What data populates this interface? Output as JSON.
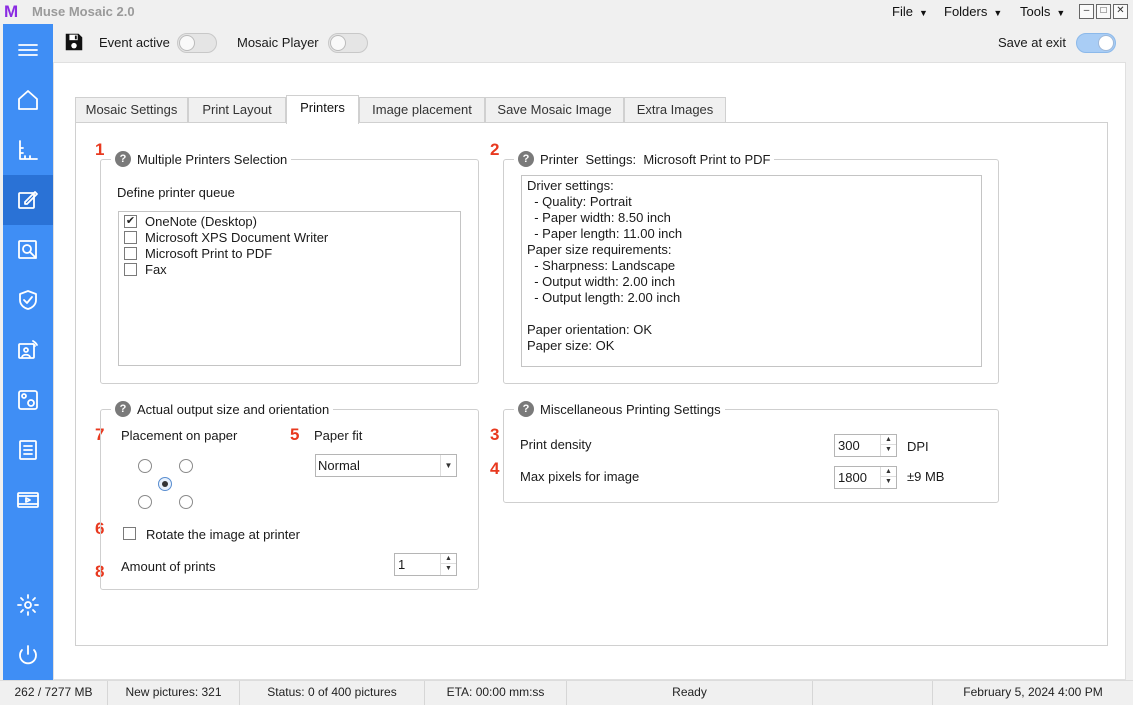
{
  "app": {
    "title": "Muse Mosaic 2.0",
    "logo": "M"
  },
  "menu": [
    "File",
    "Folders",
    "Tools"
  ],
  "window_buttons": [
    "minimize-icon",
    "maximize-icon",
    "close-icon"
  ],
  "sidebar": {
    "items": [
      {
        "icon": "hamburger-menu-icon"
      },
      {
        "icon": "home-icon"
      },
      {
        "icon": "ruler-icon"
      },
      {
        "icon": "edit-icon"
      },
      {
        "icon": "search-image-icon"
      },
      {
        "icon": "shield-check-icon"
      },
      {
        "icon": "presentation-icon"
      },
      {
        "icon": "image-settings-icon"
      },
      {
        "icon": "checklist-icon"
      },
      {
        "icon": "video-icon"
      },
      {
        "icon": "gear-icon"
      },
      {
        "icon": "power-icon"
      }
    ],
    "active_index": 3,
    "accent_color": "#3f8ef5"
  },
  "toolbar": {
    "event_active_label": "Event active",
    "event_active": false,
    "mosaic_player_label": "Mosaic Player",
    "mosaic_player": false,
    "save_at_exit_label": "Save at exit",
    "save_at_exit": true
  },
  "tabs": [
    {
      "label": "Mosaic Settings",
      "active": false
    },
    {
      "label": "Print Layout",
      "active": false
    },
    {
      "label": "Printers",
      "active": true
    },
    {
      "label": "Image placement",
      "active": false
    },
    {
      "label": "Save Mosaic Image",
      "active": false
    },
    {
      "label": "Extra Images",
      "active": false
    }
  ],
  "markers": [
    "1",
    "2",
    "3",
    "4",
    "5",
    "6",
    "7",
    "8"
  ],
  "multiple_printers": {
    "title": "Multiple Printers Selection",
    "queue_label": "Define printer queue",
    "printers": [
      {
        "name": "OneNote (Desktop)",
        "checked": true
      },
      {
        "name": "Microsoft XPS Document Writer",
        "checked": false
      },
      {
        "name": "Microsoft Print to PDF",
        "checked": false
      },
      {
        "name": "Fax",
        "checked": false
      }
    ]
  },
  "printer_settings": {
    "title": "Printer  Settings:  Microsoft Print to PDF",
    "lines": [
      "Driver settings:",
      "  - Quality: Portrait",
      "  - Paper width: 8.50 inch",
      "  - Paper length: 11.00 inch",
      "Paper size requirements:",
      "  - Sharpness: Landscape",
      "  - Output width: 2.00 inch",
      "  - Output length: 2.00 inch",
      "",
      "Paper orientation: OK",
      "Paper size: OK"
    ]
  },
  "output_size": {
    "title": "Actual output size and orientation",
    "placement_label": "Placement on paper",
    "placement_selected": "center",
    "paper_fit_label": "Paper fit",
    "paper_fit_value": "Normal",
    "rotate_label": "Rotate the image at printer",
    "rotate_checked": false,
    "amount_label": "Amount of prints",
    "amount_value": "1"
  },
  "misc": {
    "title": "Miscellaneous Printing Settings",
    "density_label": "Print density",
    "density_value": "300",
    "density_unit": "DPI",
    "max_pixels_label": "Max pixels for image",
    "max_pixels_value": "1800",
    "max_pixels_unit": "±9 MB"
  },
  "statusbar": {
    "memory": "262 / 7277 MB",
    "new_pictures": "New pictures: 321",
    "status": "Status: 0 of 400 pictures",
    "eta": "ETA: 00:00 mm:ss",
    "state": "Ready",
    "empty": "",
    "datetime": "February 5, 2024  4:00 PM"
  }
}
